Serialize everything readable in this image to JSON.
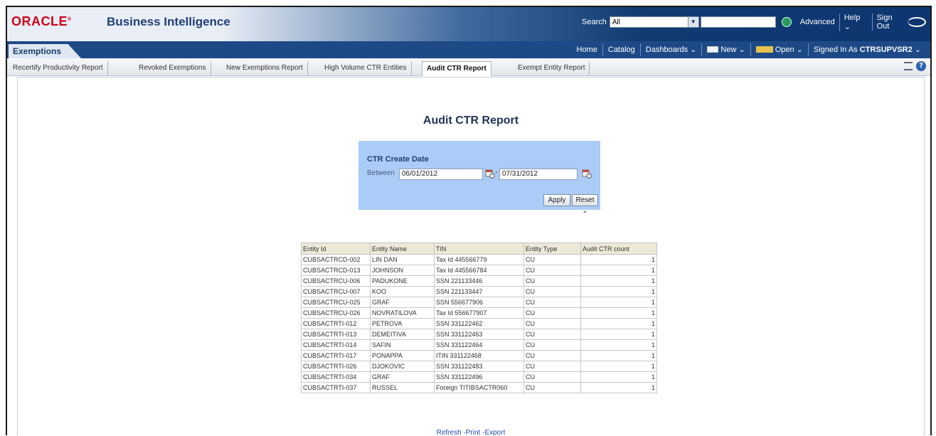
{
  "header": {
    "logo_text": "ORACLE",
    "app_title": "Business Intelligence",
    "search_label": "Search",
    "search_scope": "All",
    "search_value": "",
    "advanced_label": "Advanced",
    "help_label": "Help",
    "signout_label": "Sign Out"
  },
  "dashboard_tab": "Exemptions",
  "nav": {
    "home": "Home",
    "catalog": "Catalog",
    "dashboards": "Dashboards",
    "new": "New",
    "open": "Open",
    "signed_in_prefix": "Signed In As",
    "user": "CTRSUPVSR2"
  },
  "page_tabs": [
    "Recertify Productivity Report",
    "Revoked Exemptions",
    "New Exemptions Report",
    "High Volume CTR Entities",
    "Audit CTR Report",
    "Exempt Entity Report"
  ],
  "active_tab": "Audit CTR Report",
  "report": {
    "title": "Audit CTR Report",
    "prompt_title": "CTR Create Date",
    "between_label": "Between",
    "date_from": "06/01/2012",
    "date_to": "07/31/2012",
    "apply_label": "Apply",
    "reset_label": "Reset"
  },
  "table": {
    "columns": [
      "Entity Id",
      "Entity Name",
      "TIN",
      "Entity Type",
      "Audit CTR count"
    ],
    "rows": [
      [
        "CUBSACTRCD-002",
        "LIN DAN",
        "Tax Id 445566779",
        "CU",
        "1"
      ],
      [
        "CUBSACTRCD-013",
        "JOHNSON",
        "Tax Id 445566784",
        "CU",
        "1"
      ],
      [
        "CUBSACTRCU-006",
        "PADUKONE",
        "SSN 221133446",
        "CU",
        "1"
      ],
      [
        "CUBSACTRCU-007",
        "KOO",
        "SSN 221133447",
        "CU",
        "1"
      ],
      [
        "CUBSACTRCU-025",
        "GRAF",
        "SSN 556677906",
        "CU",
        "1"
      ],
      [
        "CUBSACTRCU-026",
        "NOVRATILOVA",
        "Tax Id 556677907",
        "CU",
        "1"
      ],
      [
        "CUBSACTRTI-012",
        "PETROVA",
        "SSN 331122462",
        "CU",
        "1"
      ],
      [
        "CUBSACTRTI-013",
        "DEMEITIVA",
        "SSN 331122463",
        "CU",
        "1"
      ],
      [
        "CUBSACTRTI-014",
        "SAFIN",
        "SSN 331122464",
        "CU",
        "1"
      ],
      [
        "CUBSACTRTI-017",
        "PONAPPA",
        "ITIN 331122468",
        "CU",
        "1"
      ],
      [
        "CUBSACTRTI-026",
        "DJOKOVIC",
        "SSN 331122483",
        "CU",
        "1"
      ],
      [
        "CUBSACTRTI-034",
        "GRAF",
        "SSN 331122496",
        "CU",
        "1"
      ],
      [
        "CUBSACTRTI-037",
        "RUSSEL",
        "Foreign TITIBSACTR060",
        "CU",
        "1"
      ]
    ]
  },
  "footer": {
    "refresh": "Refresh",
    "print": "Print",
    "export": "Export"
  }
}
